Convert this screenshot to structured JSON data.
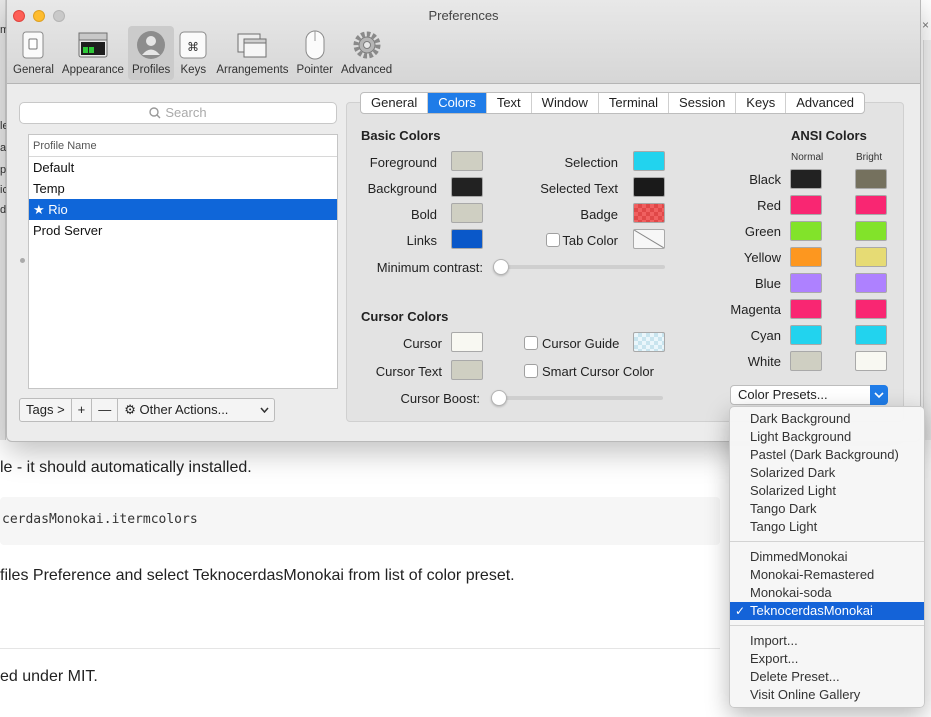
{
  "window": {
    "title": "Preferences"
  },
  "toolbar": {
    "items": [
      {
        "label": "General"
      },
      {
        "label": "Appearance"
      },
      {
        "label": "Profiles"
      },
      {
        "label": "Keys"
      },
      {
        "label": "Arrangements"
      },
      {
        "label": "Pointer"
      },
      {
        "label": "Advanced"
      }
    ],
    "selected": "Profiles"
  },
  "left": {
    "search_placeholder": "Search",
    "column_header": "Profile Name",
    "profiles": [
      "Default",
      "Temp",
      "★ Rio",
      "Prod Server"
    ],
    "selected_profile": "★ Rio",
    "tags_label": "Tags >",
    "add_label": "+",
    "remove_label": "—",
    "other_actions_label": "Other Actions..."
  },
  "tabs": {
    "items": [
      "General",
      "Colors",
      "Text",
      "Window",
      "Terminal",
      "Session",
      "Keys",
      "Advanced"
    ],
    "selected": "Colors"
  },
  "basic": {
    "title": "Basic Colors",
    "foreground": "Foreground",
    "background": "Background",
    "bold": "Bold",
    "links": "Links",
    "selection": "Selection",
    "selected_text": "Selected Text",
    "badge": "Badge",
    "tab_color": "Tab Color",
    "min_contrast": "Minimum contrast:",
    "min_contrast_value": 0
  },
  "cursor": {
    "title": "Cursor Colors",
    "cursor": "Cursor",
    "cursor_text": "Cursor Text",
    "cursor_guide": "Cursor Guide",
    "smart_cursor": "Smart Cursor Color",
    "cursor_boost": "Cursor Boost:",
    "cursor_boost_value": 0
  },
  "ansi": {
    "title": "ANSI Colors",
    "normal": "Normal",
    "bright": "Bright",
    "rows": [
      {
        "name": "Black",
        "normal": "#222222",
        "bright": "#75715e"
      },
      {
        "name": "Red",
        "normal": "#f92672",
        "bright": "#f92672"
      },
      {
        "name": "Green",
        "normal": "#82e32a",
        "bright": "#82e32a"
      },
      {
        "name": "Yellow",
        "normal": "#fd971f",
        "bright": "#e6db74"
      },
      {
        "name": "Blue",
        "normal": "#ae81ff",
        "bright": "#ae81ff"
      },
      {
        "name": "Magenta",
        "normal": "#f92672",
        "bright": "#f92672"
      },
      {
        "name": "Cyan",
        "normal": "#22d3ee",
        "bright": "#22d3ee"
      },
      {
        "name": "White",
        "normal": "#cfcfc2",
        "bright": "#f8f8f2"
      }
    ]
  },
  "colors": {
    "foreground": "#cfcfc2",
    "background": "#222222",
    "bold": "#cfcfc2",
    "links": "#0a58c9",
    "selection": "#22d3ee",
    "selected_text": "#1a1a1a",
    "cursor": "#f8f8f2",
    "cursor_text": "#cfcfc2",
    "accent": "#1f7ce8"
  },
  "presets": {
    "button_label": "Color Presets...",
    "group1": [
      "Dark Background",
      "Light Background",
      "Pastel (Dark Background)",
      "Solarized Dark",
      "Solarized Light",
      "Tango Dark",
      "Tango Light"
    ],
    "group2": [
      "DimmedMonokai",
      "Monokai-Remastered",
      "Monokai-soda",
      "TeknocerdasMonokai"
    ],
    "selected": "TeknocerdasMonokai",
    "group3": [
      "Import...",
      "Export...",
      "Delete Preset...",
      "Visit Online Gallery"
    ]
  },
  "background_doc": {
    "line1": "le - it should automatically installed.",
    "code": "cerdasMonokai.itermcolors",
    "line2": "files Preference and select TeknocerdasMonokai from list of color preset.",
    "line3": "ed under MIT.",
    "strip_chars": [
      "m",
      "le",
      "a",
      "p",
      "ic",
      "d",
      "×"
    ]
  }
}
